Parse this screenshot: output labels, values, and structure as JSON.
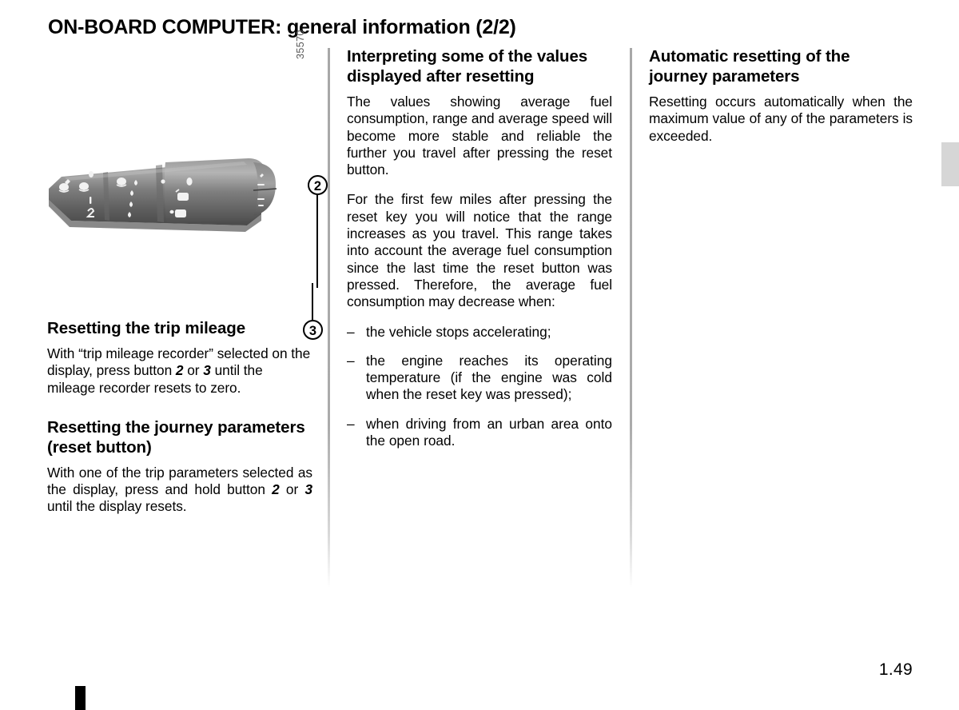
{
  "page": {
    "title": "ON-BOARD COMPUTER: general information (2/2)",
    "number": "1.49",
    "figure_reference": "35570"
  },
  "figure": {
    "ref": "35570",
    "alt": "wiper-stalk-photo",
    "callouts": [
      {
        "id": "2",
        "label": "2"
      },
      {
        "id": "3",
        "label": "3"
      }
    ]
  },
  "columns": {
    "left": {
      "sections": [
        {
          "heading": "Resetting the trip mileage",
          "paragraphs": [
            {
              "parts": [
                {
                  "text": "With “trip mileage recorder” selected on the display, press button "
                },
                {
                  "text": "2",
                  "emphasis": true
                },
                {
                  "text": " or "
                },
                {
                  "text": "3",
                  "emphasis": true
                },
                {
                  "text": " until the mileage recorder resets to zero."
                }
              ]
            }
          ]
        },
        {
          "heading": "Resetting the journey parameters (reset button)",
          "paragraphs": [
            {
              "parts": [
                {
                  "text": "With one of the trip parameters selected as the display, press and hold button "
                },
                {
                  "text": "2",
                  "emphasis": true
                },
                {
                  "text": " or "
                },
                {
                  "text": "3",
                  "emphasis": true
                },
                {
                  "text": " until the display resets."
                }
              ]
            }
          ]
        }
      ]
    },
    "middle": {
      "heading": "Interpreting some of the values displayed after resetting",
      "paragraph_1": "The values showing average fuel consumption, range and average speed will become more stable and reliable the further you travel after pressing the reset button.",
      "paragraph_2": "For the first few miles after pressing the reset key you will notice that the range increases as you travel. This range takes into account the average fuel consumption since the last time the reset button was pressed. Therefore, the average fuel consumption may decrease when:",
      "bullet_dash": "–",
      "bullets": [
        "the vehicle stops accelerating;",
        "the engine reaches its operating temperature (if the engine was cold when the reset key was pressed);",
        "when driving from an urban area onto the open road."
      ]
    },
    "right": {
      "heading": "Automatic resetting of the journey parameters",
      "paragraph_1": "Resetting occurs automatically when the maximum value of any of the parameters is exceeded."
    }
  },
  "colors": {
    "text": "#000000",
    "background": "#ffffff",
    "divider": "#a8a8a8",
    "edge_tab": "#d6d6d6",
    "figure_ref": "#5a5a5a",
    "bottom_mark": "#000000"
  }
}
